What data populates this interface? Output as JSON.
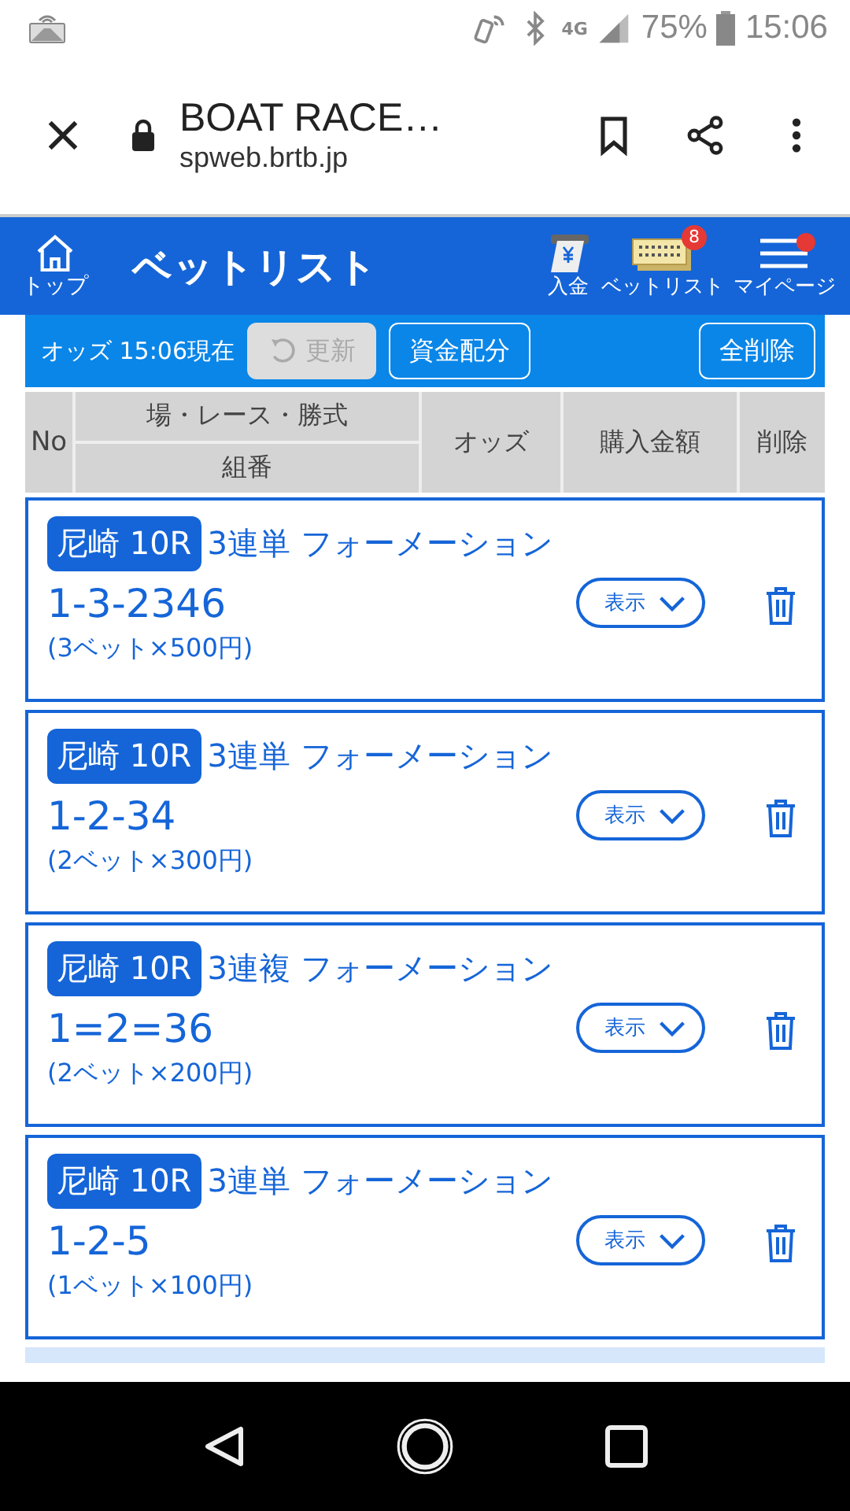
{
  "status_bar": {
    "battery": "75%",
    "network": "4G",
    "time": "15:06"
  },
  "browser": {
    "title": "BOAT RACE…",
    "url": "spweb.brtb.jp"
  },
  "header": {
    "title": "ベットリスト",
    "home_label": "トップ",
    "nav": [
      {
        "kind": "deposit",
        "label": "入金"
      },
      {
        "kind": "betlist",
        "label": "ベットリスト",
        "badge": "8"
      },
      {
        "kind": "mypage",
        "label": "マイページ"
      }
    ]
  },
  "toolbar": {
    "odds_time": "オッズ 15:06現在",
    "buttons": [
      {
        "label": "更新",
        "kind": "refresh",
        "disabled": true
      },
      {
        "label": "資金配分",
        "kind": "plain",
        "disabled": false
      },
      {
        "label": "全削除",
        "kind": "plain",
        "disabled": false
      }
    ]
  },
  "table": {
    "columns": {
      "no": "No",
      "race": "場・レース・勝式",
      "combo": "組番",
      "odds": "オッズ",
      "amount": "購入金額",
      "delete": "削除"
    },
    "rows": [
      {
        "venue": "尼崎 10R",
        "bet_type": "3連単 フォーメーション",
        "combo": "1-3-2346",
        "detail": "(3ベット×500円)",
        "toggle": "表示"
      },
      {
        "venue": "尼崎 10R",
        "bet_type": "3連単 フォーメーション",
        "combo": "1-2-34",
        "detail": "(2ベット×300円)",
        "toggle": "表示"
      },
      {
        "venue": "尼崎 10R",
        "bet_type": "3連複 フォーメーション",
        "combo": "1=2=36",
        "detail": "(2ベット×200円)",
        "toggle": "表示"
      },
      {
        "venue": "尼崎 10R",
        "bet_type": "3連単 フォーメーション",
        "combo": "1-2-5",
        "detail": "(1ベット×100円)",
        "toggle": "表示"
      }
    ]
  }
}
